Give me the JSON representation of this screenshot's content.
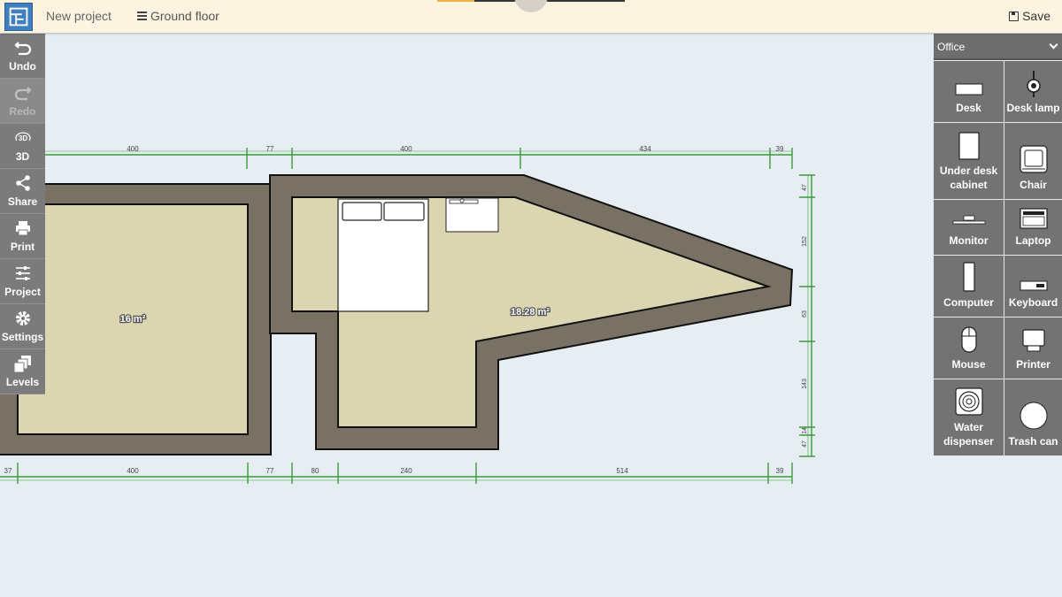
{
  "header": {
    "project_name": "New project",
    "level_label": "Ground floor",
    "save_label": "Save"
  },
  "toolbar": {
    "undo": "Undo",
    "redo": "Redo",
    "view3d": "3D",
    "view3d_badge": "3D",
    "share": "Share",
    "print": "Print",
    "project": "Project",
    "settings": "Settings",
    "levels": "Levels"
  },
  "plan": {
    "room1_area": "16 m²",
    "room2_area": "18.28 m²",
    "top_dims": [
      "400",
      "77",
      "400",
      "434",
      "39"
    ],
    "bottom_dims": [
      "37",
      "400",
      "77",
      "80",
      "240",
      "514",
      "39"
    ],
    "right_dims": [
      "47",
      "152",
      "63",
      "143",
      "14",
      "47"
    ]
  },
  "furniture": {
    "category": "Office",
    "items": [
      {
        "label": "Desk",
        "icon": "desk-icon"
      },
      {
        "label": "Desk lamp",
        "icon": "desk-lamp-icon"
      },
      {
        "label": "Under desk cabinet",
        "icon": "cabinet-icon"
      },
      {
        "label": "Chair",
        "icon": "chair-icon"
      },
      {
        "label": "Monitor",
        "icon": "monitor-icon"
      },
      {
        "label": "Laptop",
        "icon": "laptop-icon"
      },
      {
        "label": "Computer",
        "icon": "computer-icon"
      },
      {
        "label": "Keyboard",
        "icon": "keyboard-icon"
      },
      {
        "label": "Mouse",
        "icon": "mouse-icon"
      },
      {
        "label": "Printer",
        "icon": "printer-icon"
      },
      {
        "label": "Water dispenser",
        "icon": "water-dispenser-icon"
      },
      {
        "label": "Trash can",
        "icon": "trash-can-icon"
      }
    ]
  },
  "colors": {
    "wall": "#7a7165",
    "floor": "#dbd5b2",
    "dimension": "#3a9a3a",
    "panel": "#737373"
  }
}
